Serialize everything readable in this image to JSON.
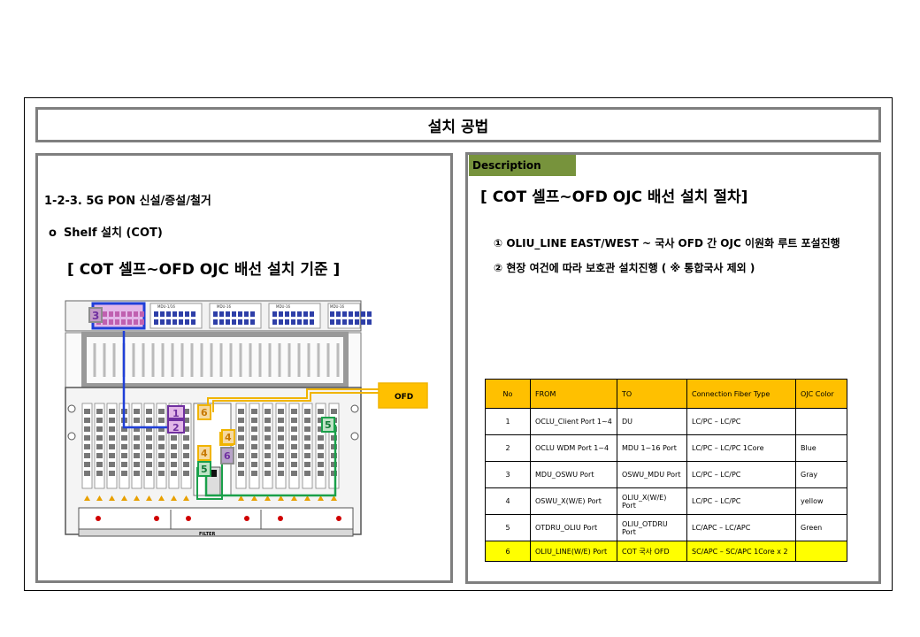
{
  "title": "설치 공법",
  "left": {
    "heading": "1-2-3. 5G PON 신설/증설/철거",
    "bullet_mark": "o",
    "bullet": "Shelf 설치 (COT)",
    "standard_title": "[ COT 셀프~OFD OJC 배선 설치 기준 ]"
  },
  "diagram": {
    "ofd_label": "OFD",
    "filter_label": "FILTER",
    "card_labels": [
      "MDU-OSWU",
      "MDU-1/16",
      "MDU-16",
      "MDU-16",
      "MDU-16"
    ],
    "markers": [
      "1",
      "2",
      "3",
      "4",
      "4",
      "5",
      "5",
      "6",
      "6"
    ],
    "colors": {
      "blue": "#1f3fd8",
      "yellow": "#f0b400",
      "green": "#1aa04a",
      "purple": "#7030a0",
      "gray": "#8c8c8c"
    }
  },
  "right": {
    "badge": "Description",
    "title": "[ COT 셀프~OFD OJC 배선 설치 절차]",
    "steps": [
      "① OLIU_LINE EAST/WEST ~ 국사 OFD 간 OJC 이원화 루트 포설진행",
      "② 현장 여건에 따라 보호관 설치진행 ( ※ 통합국사 제외 )"
    ]
  },
  "table": {
    "headers": [
      "No",
      "FROM",
      "TO",
      "Connection  Fiber  Type",
      "OJC Color"
    ],
    "rows": [
      {
        "no": "1",
        "from": "OCLU_Client Port 1~4",
        "to": "DU",
        "type": "LC/PC – LC/PC",
        "color": ""
      },
      {
        "no": "2",
        "from": "OCLU WDM Port 1~4",
        "to": "MDU 1~16  Port",
        "type": "LC/PC – LC/PC 1Core",
        "color": "Blue"
      },
      {
        "no": "3",
        "from": "MDU_OSWU Port",
        "to": "OSWU_MDU Port",
        "type": "LC/PC – LC/PC",
        "color": "Gray"
      },
      {
        "no": "4",
        "from": "OSWU_X(W/E) Port",
        "to": "OLIU_X(W/E) Port",
        "type": "LC/PC – LC/PC",
        "color": "yellow"
      },
      {
        "no": "5",
        "from": "OTDRU_OLIU Port",
        "to": "OLIU_OTDRU Port",
        "type": "LC/APC – LC/APC",
        "color": "Green"
      },
      {
        "no": "6",
        "from": "OLIU_LINE(W/E) Port",
        "to": "COT 국사 OFD",
        "type": "SC/APC – SC/APC 1Core x 2",
        "color": ""
      }
    ]
  }
}
